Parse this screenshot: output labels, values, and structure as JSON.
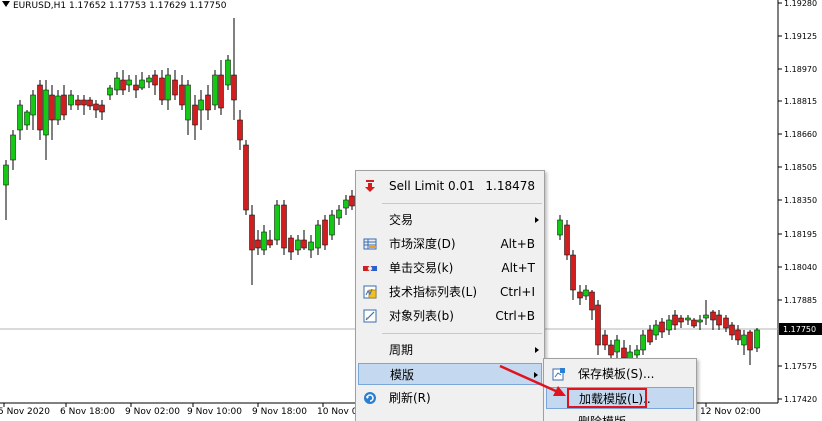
{
  "chart": {
    "title": "EURUSD,H1  1.17652 1.17753 1.17629 1.17750",
    "price_levels": [
      "1.19280",
      "1.19125",
      "1.18970",
      "1.18815",
      "1.18660",
      "1.18505",
      "1.18350",
      "1.18195",
      "1.18040",
      "1.17885",
      "1.17750",
      "1.17575",
      "1.17420"
    ],
    "current_price": "1.17750",
    "time_labels": [
      "5 Nov 2020",
      "6 Nov 18:00",
      "9 Nov 02:00",
      "9 Nov 10:00",
      "9 Nov 18:00",
      "10 Nov 0",
      "12 Nov 02:00"
    ],
    "colors": {
      "bull": "#16c816",
      "bear": "#d21e1e",
      "wick": "#000000",
      "price_line": "#b4b4b4",
      "price_tag_bg": "#000000",
      "price_tag_fg": "#ffffff"
    }
  },
  "context_menu": {
    "items": [
      {
        "icon": "sell-limit-icon",
        "label": "Sell Limit 0.01",
        "shortcut": "1.18478"
      },
      {
        "icon": "",
        "label": "交易",
        "shortcut": "",
        "submenu": true
      },
      {
        "icon": "market-depth-icon",
        "label": "市场深度(D)",
        "shortcut": "Alt+B"
      },
      {
        "icon": "one-click-trading-icon",
        "label": "单击交易(k)",
        "shortcut": "Alt+T"
      },
      {
        "icon": "indicators-list-icon",
        "label": "技术指标列表(L)",
        "shortcut": "Ctrl+I"
      },
      {
        "icon": "objects-list-icon",
        "label": "对象列表(b)",
        "shortcut": "Ctrl+B"
      },
      {
        "icon": "",
        "label": "周期",
        "shortcut": "",
        "submenu": true
      },
      {
        "icon": "",
        "label": "模版",
        "shortcut": "",
        "submenu": true
      },
      {
        "icon": "refresh-icon",
        "label": "刷新(R)",
        "shortcut": ""
      }
    ]
  },
  "template_submenu": {
    "items": [
      {
        "icon": "save-template-icon",
        "label": "保存模板(S)..."
      },
      {
        "icon": "",
        "label": "加载模版(L).."
      },
      {
        "icon": "",
        "label": "删除模版"
      }
    ]
  }
}
